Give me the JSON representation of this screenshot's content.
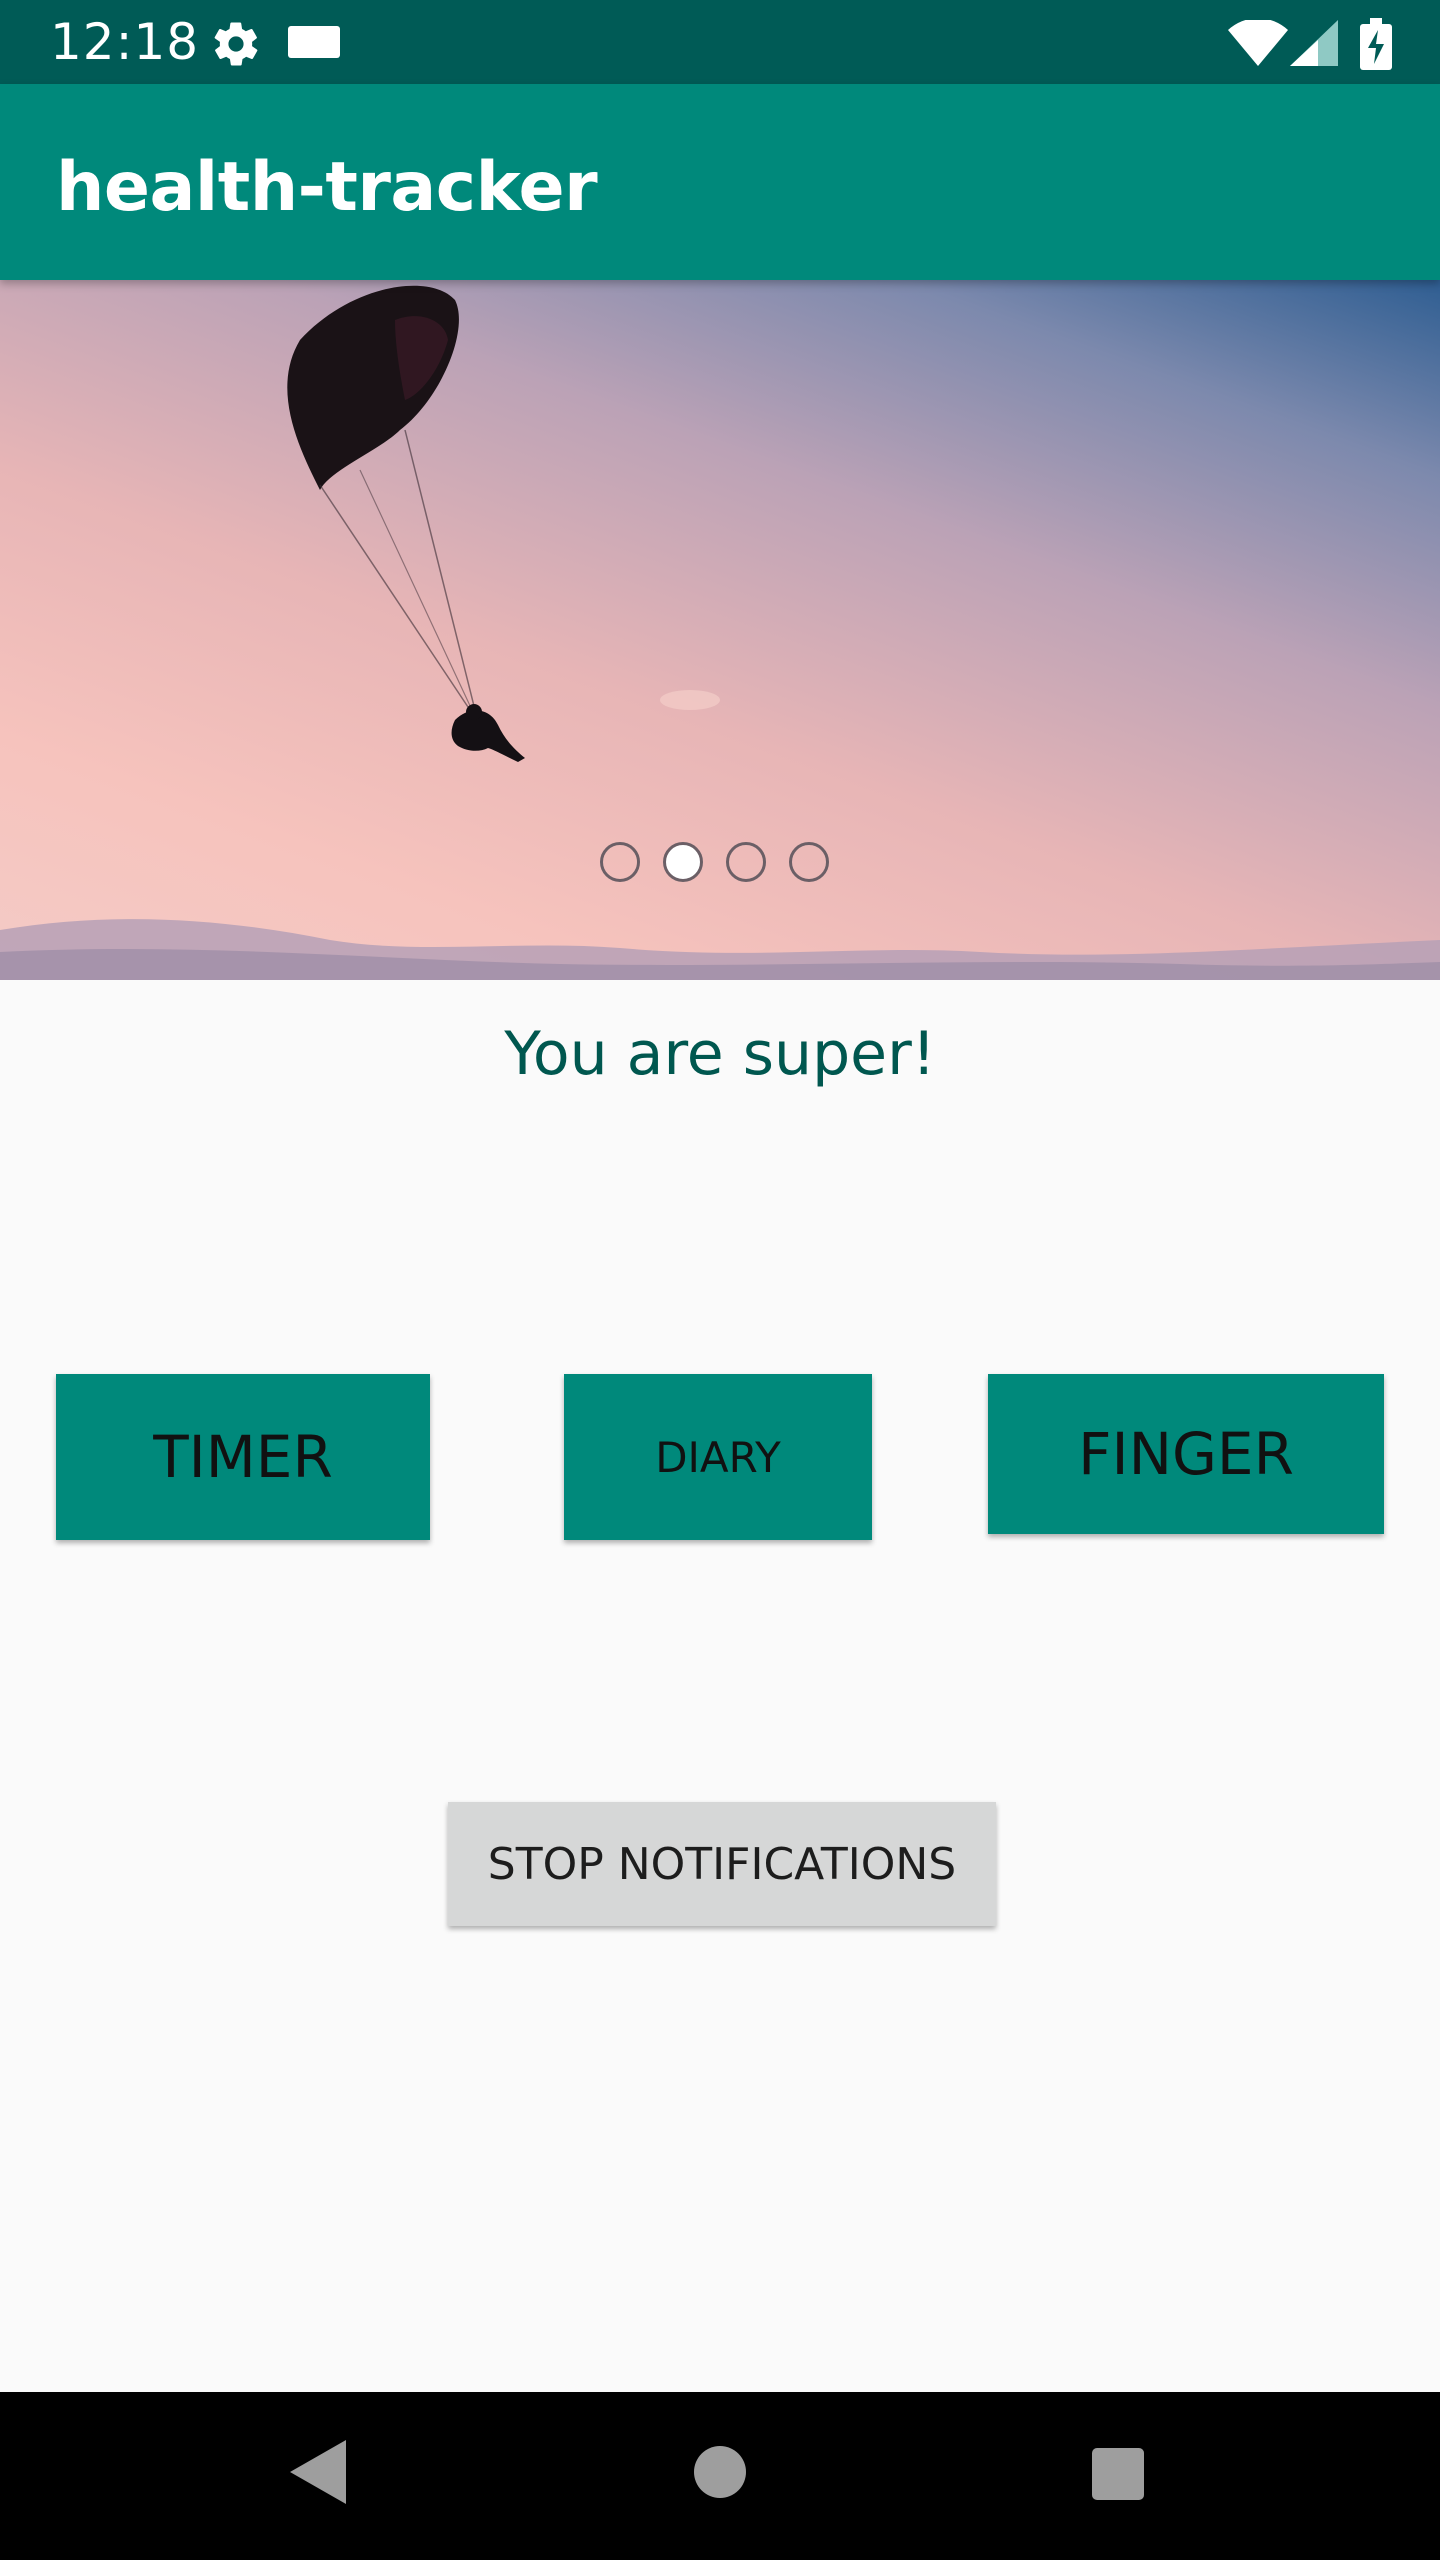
{
  "status_bar": {
    "time": "12:18",
    "icons": [
      "gear-icon",
      "sd-card-icon",
      "wifi-icon",
      "signal-icon",
      "battery-charging-icon"
    ]
  },
  "app_bar": {
    "title": "health-tracker"
  },
  "carousel": {
    "image": "paraglider-sunset-image",
    "page_count": 4,
    "active_index": 1
  },
  "main": {
    "motivation_text": "You are super!",
    "buttons": {
      "timer": "TIMER",
      "diary": "DIARY",
      "finger": "FINGER",
      "stop_notifications": "STOP NOTIFICATIONS"
    }
  },
  "nav_bar": {
    "icons": [
      "back-icon",
      "home-icon",
      "recents-icon"
    ]
  },
  "colors": {
    "status_bar": "#005b56",
    "app_bar": "#00897b",
    "accent_text": "#00574f",
    "button_primary": "#00897b",
    "button_secondary": "#d6d7d7",
    "background": "#fafafa"
  }
}
